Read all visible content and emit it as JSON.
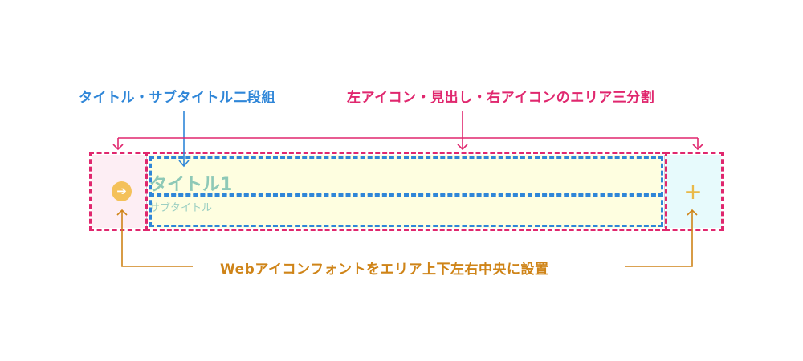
{
  "annotations": {
    "title_subtitle_two_rows": "タイトル・サブタイトル二段組",
    "three_area_split": "左アイコン・見出し・右アイコンのエリア三分割",
    "webfont_icon_centered": "Webアイコンフォントをエリア上下左右中央に設置"
  },
  "header_bar": {
    "left_icon": "arrow-right-circle-icon",
    "left_icon_glyph": "➔",
    "title": "タイトル1",
    "subtitle": "サブタイトル",
    "right_icon": "plus-icon",
    "right_icon_glyph": "+"
  },
  "colors": {
    "annotation_blue": "#2f86d8",
    "annotation_pink": "#e0276e",
    "annotation_orange": "#cf8418",
    "left_area": "#fdeef4",
    "middle_area": "#fefee0",
    "right_area": "#e7fafc",
    "icon_yellow": "#f4c15a",
    "title_green": "#8ec9b7"
  }
}
